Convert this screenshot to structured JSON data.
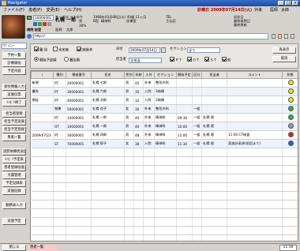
{
  "window": {
    "title": "Navigator"
  },
  "menu": {
    "items": [
      "ファイル(F)",
      "患者(P)",
      "変更(E)",
      "ヘルプ(H)"
    ],
    "notice": "診療日 2009年07月14日(火)",
    "notice2": "外来",
    "doctor_label": "医師",
    "doctor_name": "太郎"
  },
  "patient": {
    "id": "10000001",
    "kana": "サッポロ イチロウ",
    "name": "札幌 一郎",
    "sex": "男",
    "birth": "1968年03月08日(火) 40歳 11ヶ月",
    "blood": "B型",
    "blood_label": "血液型",
    "dept": "精神科",
    "ward": "診療室",
    "tel_label": "TEL",
    "address": "主な話",
    "first_visit_label": "初診日",
    "last_visit_label": "最終来院日",
    "last_visit2_label": "最終更新",
    "doctor_label": "医師",
    "doctor": "太郎",
    "ratio": "30%"
  },
  "address_bar": {
    "value": "http://",
    "label": "病院 訪室"
  },
  "sidebar": {
    "dropdown": "ｻﾌﾞﾒﾆｭｰ",
    "buttons": [
      "予約一覧",
      "診療録画",
      "予定内容",
      "受付情報入力",
      "実施伝票",
      "ﾘﾊﾋﾞﾘ終了",
      "担当者登録",
      "担当予定実施",
      "担当予定登録",
      "患者一覧",
      "読影依頼状送信",
      "ﾘﾊﾋﾞﾘ予定表",
      "患者登録画面",
      "文書管理",
      "予定記録表",
      "実施記録",
      "勤務表入力",
      "実施予定"
    ],
    "bottom_button": "閉じる"
  },
  "filters": {
    "group_label": "種 別",
    "opt_unfinished": "未実施",
    "opt_finished": "実施済",
    "opt_scheduled": "開始予定順",
    "opt_type": "種別順",
    "date_label": "日付",
    "date_value": "2009年07月14日",
    "section_label": "セクション",
    "section_value": "全て",
    "staff_label": "担当者",
    "staff_value": "全担当",
    "pt": "ＰＴ",
    "ot": "ＯＴ",
    "st": "ＳＴ",
    "other": "他",
    "refresh_button": "再表示",
    "cancel_button": "取消"
  },
  "table": {
    "columns": [
      "!",
      "種別",
      "患者番号",
      "氏名",
      "性別",
      "年齢",
      "入外",
      "セクション",
      "開始予定",
      "区分",
      "担当者",
      "コメント",
      "状態"
    ],
    "rows": [
      {
        "date": "",
        "flag": "新規",
        "type": "PT",
        "id": "20000001",
        "name": "札幌 七郎",
        "sex": "男",
        "age": "45",
        "io": "外来",
        "section": "整形外科",
        "start": "",
        "kubun": "",
        "staff": "",
        "comment": "",
        "status_color": "#f4e600"
      },
      {
        "date": "",
        "flag": "優先",
        "type": "PT",
        "id": "30000001",
        "name": "札幌 六郎",
        "sex": "男",
        "age": "35",
        "io": "入院",
        "section": "3病棟",
        "start": "",
        "kubun": "",
        "staff": "",
        "comment": "",
        "status_color": "#f4e600"
      },
      {
        "date": "",
        "flag": "順延",
        "type": "PT",
        "id": "40000001",
        "name": "札幌 次郎",
        "sex": "男",
        "age": "32",
        "io": "入院",
        "section": "3病棟",
        "start": "",
        "kubun": "",
        "staff": "",
        "comment": "",
        "status_color": "#f4e600"
      },
      {
        "date": "",
        "flag": "",
        "type": "物療",
        "id": "50000001",
        "name": "札幌 花子",
        "sex": "女",
        "age": "30",
        "io": "外来",
        "section": "整形外科",
        "start": "",
        "kubun": "一般",
        "staff": "",
        "comment": "",
        "status_color": "#2db34a"
      },
      {
        "date": "",
        "flag": "",
        "type": "PT",
        "id": "10000001",
        "name": "札幌 一郎",
        "sex": "男",
        "age": "40",
        "io": "外来",
        "section": "精神科",
        "start": "09:30",
        "kubun": "一般",
        "staff": "札幌 理",
        "comment": "",
        "status_color": "#2db34a"
      },
      {
        "date": "",
        "flag": "",
        "type": "OT",
        "id": "10000001",
        "name": "札幌 一郎",
        "sex": "男",
        "age": "40",
        "io": "外来",
        "section": "精神科",
        "start": "10:00",
        "kubun": "一般",
        "staff": "札幌 理",
        "comment": "",
        "status_color": "#9a9a9a"
      },
      {
        "date": "2009/07/23",
        "flag": "",
        "type": "PT",
        "id": "30000001",
        "name": "札幌 四郎",
        "sex": "男",
        "age": "48",
        "io": "外来",
        "section": "精神科",
        "start": "11:00",
        "kubun": "一般",
        "staff": "札幌 理",
        "comment": "11:00 CT検査",
        "status_color": "#e02020"
      },
      {
        "date": "",
        "flag": "",
        "type": "ST",
        "id": "70000001",
        "name": "札幌 智子",
        "sex": "女",
        "age": "38",
        "io": "入院",
        "section": "精神科",
        "start": "11:30",
        "kubun": "一般",
        "staff": "札幌 理",
        "comment": "実施計画済(前回まで)",
        "status_color": "#2060d0"
      }
    ]
  },
  "status": {
    "left": "閉じる",
    "center": "患者一覧",
    "time": "11:16"
  }
}
